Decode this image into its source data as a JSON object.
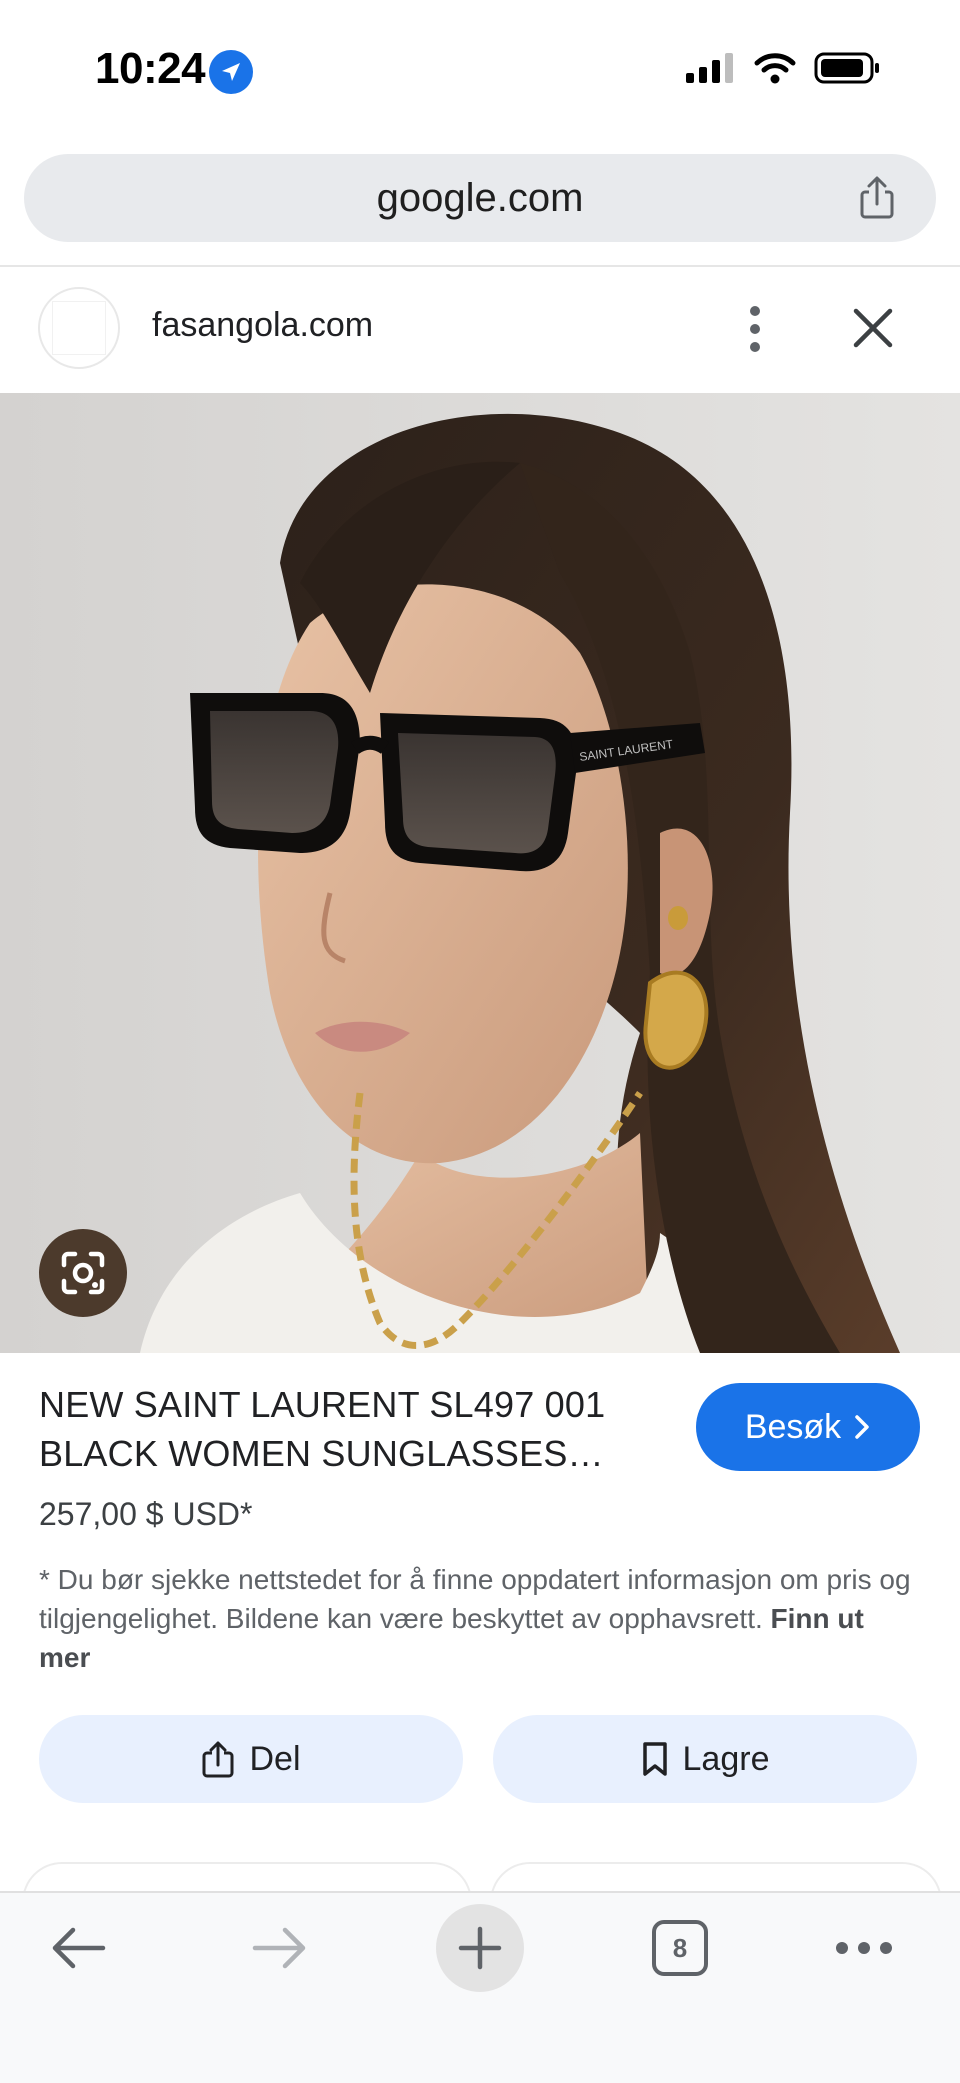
{
  "status_bar": {
    "time": "10:24"
  },
  "browser": {
    "url": "google.com"
  },
  "site": {
    "name": "fasangola.com"
  },
  "product": {
    "title_line1": "NEW SAINT LAURENT SL497 001",
    "title_line2": "BLACK WOMEN SUNGLASSES…",
    "price": "257,00 $ USD*",
    "visit_label": "Besøk",
    "disclaimer": "* Du bør sjekke nettstedet for å finne oppdatert informasjon om pris og tilgjengelighet. Bildene kan være beskyttet av opphavsrett.",
    "learn_more": "Finn ut mer",
    "frame_brand": "SAINT LAURENT"
  },
  "actions": {
    "share_label": "Del",
    "save_label": "Lagre"
  },
  "toolbar": {
    "tab_count": "8"
  },
  "colors": {
    "accent": "#1a73e8",
    "chip_bg": "#e8f0fe"
  },
  "icons": [
    "location-arrow-icon",
    "signal-icon",
    "wifi-icon",
    "battery-icon",
    "share-icon",
    "more-vert-icon",
    "close-icon",
    "google-lens-icon",
    "chevron-right-icon",
    "bookmark-icon",
    "back-icon",
    "forward-icon",
    "plus-icon",
    "more-horiz-icon"
  ]
}
